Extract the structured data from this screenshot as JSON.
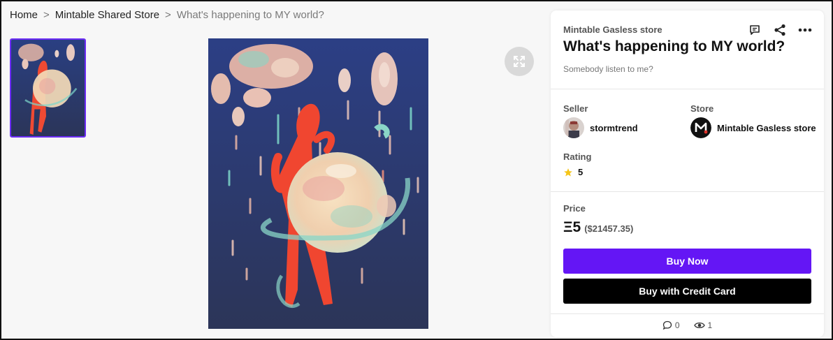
{
  "breadcrumb": {
    "home": "Home",
    "store": "Mintable Shared Store",
    "current": "What's happening to MY world?",
    "separator": ">"
  },
  "item": {
    "store_name": "Mintable Gasless store",
    "title": "What's happening to MY world?",
    "subtitle": "Somebody listen to me?"
  },
  "seller": {
    "label": "Seller",
    "name": "stormtrend"
  },
  "store": {
    "label": "Store",
    "name": "Mintable Gasless store"
  },
  "rating": {
    "label": "Rating",
    "value": "5"
  },
  "price": {
    "label": "Price",
    "eth": "Ξ5",
    "usd": "($21457.35)"
  },
  "buttons": {
    "buy_now": "Buy Now",
    "buy_card": "Buy with Credit Card"
  },
  "stats": {
    "comments": "0",
    "views": "1"
  },
  "icons": {
    "comment": "comment-icon",
    "share": "share-icon",
    "more": "more-icon",
    "expand": "expand-icon",
    "star": "star-icon",
    "eye": "eye-icon"
  },
  "colors": {
    "accent": "#6416f5",
    "card_button": "#000000",
    "star": "#f5c518"
  }
}
